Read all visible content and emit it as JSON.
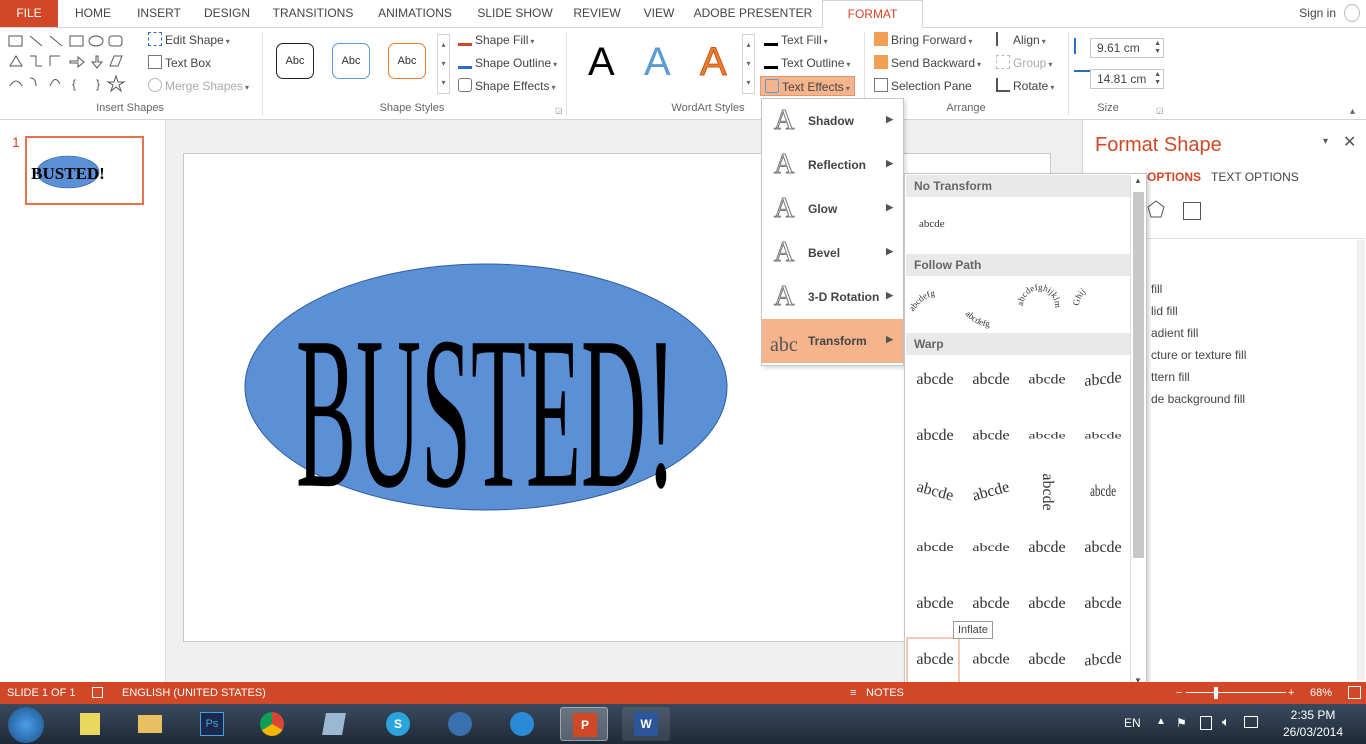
{
  "ribbon_tabs": [
    "FILE",
    "HOME",
    "INSERT",
    "DESIGN",
    "TRANSITIONS",
    "ANIMATIONS",
    "SLIDE SHOW",
    "REVIEW",
    "VIEW",
    "ADOBE PRESENTER",
    "FORMAT"
  ],
  "signin": "Sign in",
  "insert_shapes": {
    "edit_shape": "Edit Shape",
    "text_box": "Text Box",
    "merge_shapes": "Merge Shapes",
    "label": "Insert Shapes"
  },
  "shape_styles": {
    "sample": "Abc",
    "fill": "Shape Fill",
    "outline": "Shape Outline",
    "effects": "Shape Effects",
    "label": "Shape Styles"
  },
  "wordart_styles": {
    "letter": "A",
    "text_fill": "Text Fill",
    "text_outline": "Text Outline",
    "text_effects": "Text Effects",
    "label": "WordArt Styles"
  },
  "arrange": {
    "bring_forward": "Bring Forward",
    "send_backward": "Send Backward",
    "selection_pane": "Selection Pane",
    "align": "Align",
    "group": "Group",
    "rotate": "Rotate",
    "label": "Arrange"
  },
  "size": {
    "height": "9.61 cm",
    "width": "14.81 cm",
    "label": "Size"
  },
  "slide_number": "1",
  "slide_text": "BUSTED!",
  "text_effects_menu": [
    {
      "label": "Shadow",
      "icon": "A"
    },
    {
      "label": "Reflection",
      "icon": "A"
    },
    {
      "label": "Glow",
      "icon": "A"
    },
    {
      "label": "Bevel",
      "icon": "A"
    },
    {
      "label": "3-D Rotation",
      "icon": "A"
    },
    {
      "label": "Transform",
      "icon": "abc"
    }
  ],
  "transform_gallery": {
    "no_transform": "No Transform",
    "plain_sample": "abcde",
    "follow_path": "Follow Path",
    "path_samples": [
      "abcdefg",
      "abcdefg",
      "abcdefghijklm",
      "Ghij"
    ],
    "warp": "Warp",
    "warp_sample": "abcde",
    "tooltip": "Inflate"
  },
  "format_pane": {
    "title": "Format Shape",
    "tab1": "OPTIONS",
    "tab2": "TEXT OPTIONS",
    "fill_options": [
      "fill",
      "lid fill",
      "adient fill",
      "cture or texture fill",
      "ttern fill",
      "de background fill"
    ]
  },
  "status": {
    "slide": "SLIDE 1 OF 1",
    "language": "ENGLISH (UNITED STATES)",
    "notes": "NOTES",
    "zoom": "68%"
  },
  "taskbar": {
    "lang": "EN",
    "time": "2:35 PM",
    "date": "26/03/2014"
  },
  "colors": {
    "accent": "#d24726",
    "ellipse": "#5b8fd6",
    "menu_highlight": "#f5b48c"
  }
}
